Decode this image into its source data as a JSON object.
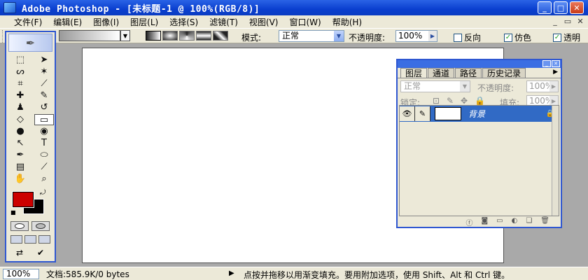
{
  "window": {
    "title": "Adobe Photoshop - [未标题-1 @ 100%(RGB/8)]"
  },
  "menu": [
    {
      "label": "文件(F)"
    },
    {
      "label": "编辑(E)"
    },
    {
      "label": "图像(I)"
    },
    {
      "label": "图层(L)"
    },
    {
      "label": "选择(S)"
    },
    {
      "label": "滤镜(T)"
    },
    {
      "label": "视图(V)"
    },
    {
      "label": "窗口(W)"
    },
    {
      "label": "帮助(H)"
    }
  ],
  "options": {
    "mode_label": "模式:",
    "mode_value": "正常",
    "opacity_label": "不透明度:",
    "opacity_value": "100%",
    "reverse_label": "反向",
    "reverse_checked": false,
    "dither_label": "仿色",
    "dither_checked": true,
    "transparency_label": "透明",
    "transparency_checked": true
  },
  "colors": {
    "foreground": "#cc0000",
    "background": "#000000"
  },
  "layers_panel": {
    "tabs": [
      {
        "label": "图层"
      },
      {
        "label": "通道"
      },
      {
        "label": "路径"
      },
      {
        "label": "历史记录"
      }
    ],
    "blend_mode": "正常",
    "opacity_label": "不透明度:",
    "opacity_value": "100%",
    "lock_label": "锁定:",
    "fill_label": "填充:",
    "fill_value": "100%",
    "layers": [
      {
        "name": "背景",
        "locked": true,
        "selected": true
      }
    ]
  },
  "status": {
    "zoom": "100%",
    "doc_info": "文档:585.9K/0 bytes",
    "hint": "点按并拖移以用渐变填充。要用附加选项，使用 Shift、Alt 和 Ctrl 键。"
  }
}
